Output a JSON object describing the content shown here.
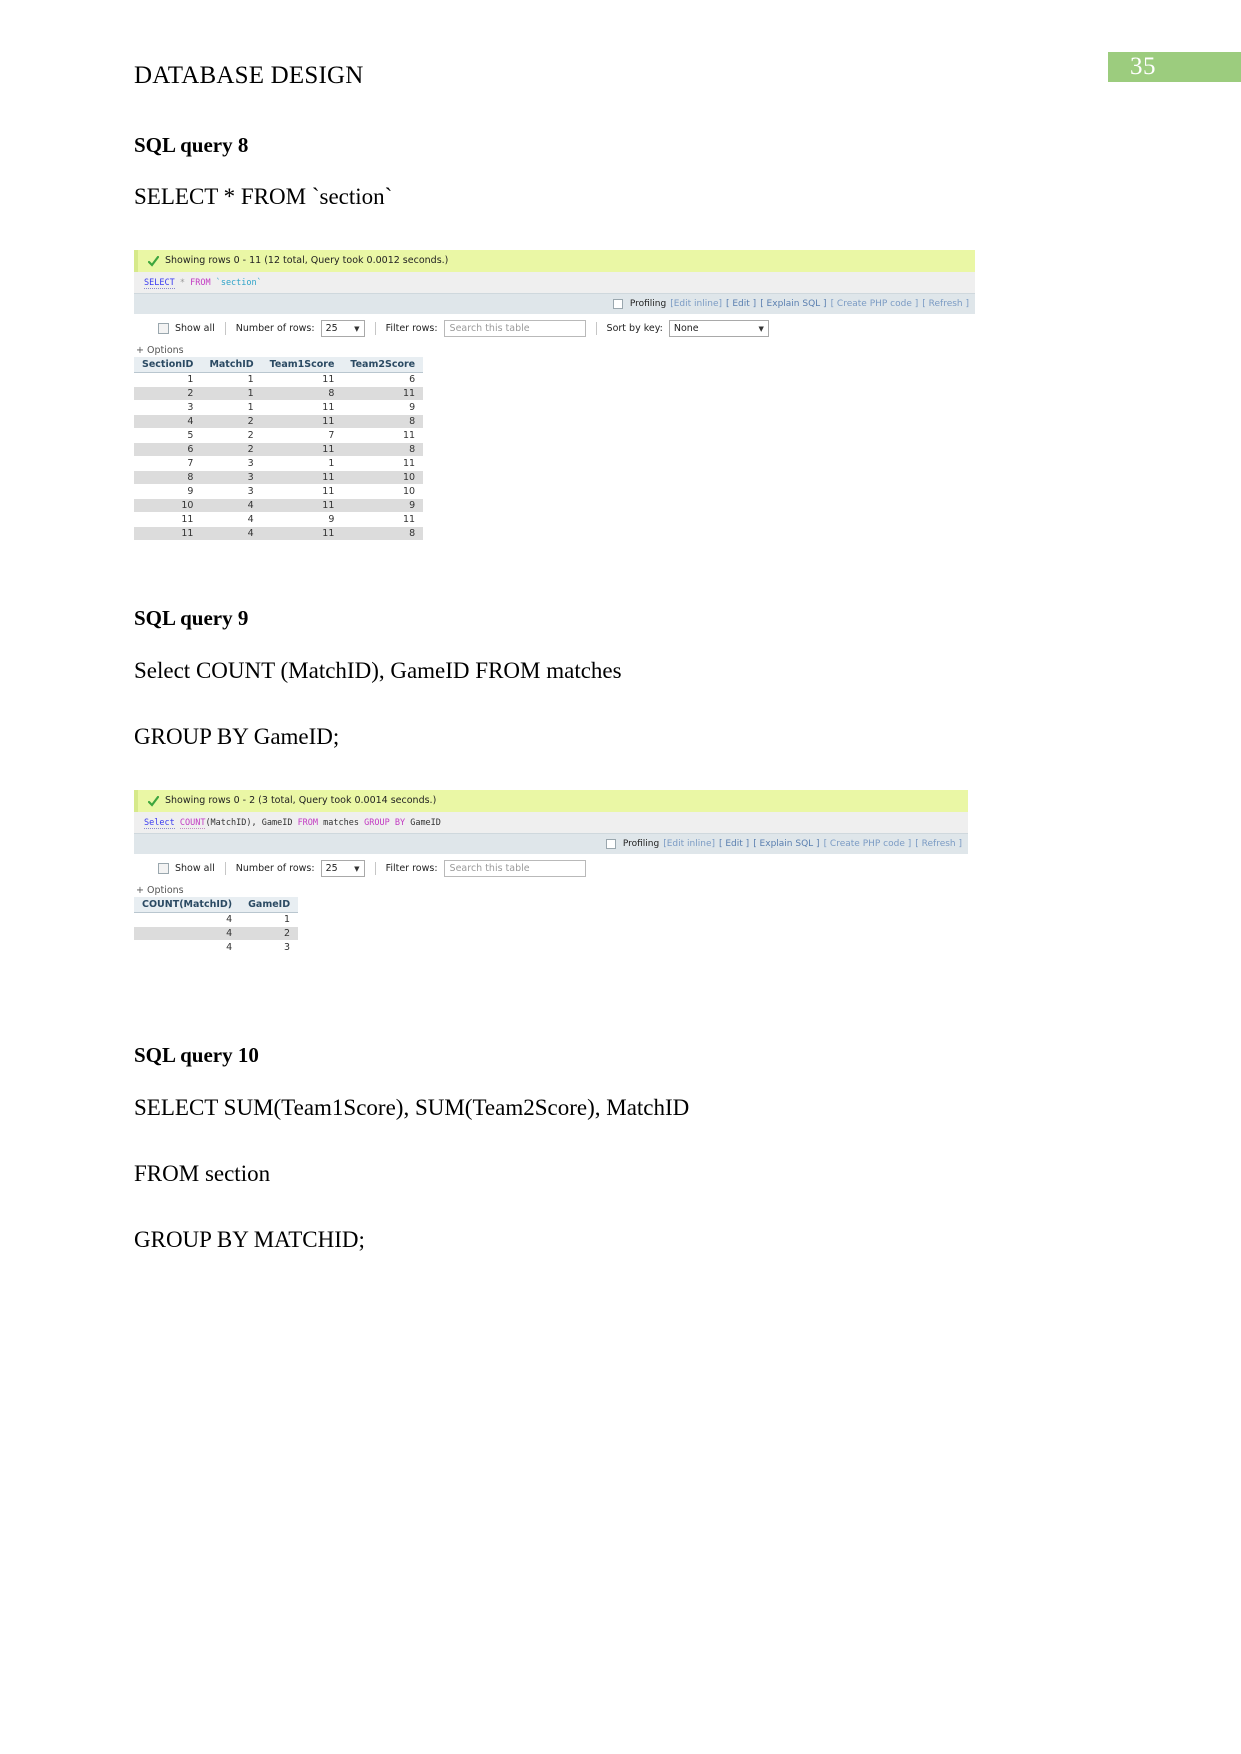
{
  "page": {
    "number": "35",
    "header_title": "DATABASE DESIGN",
    "badge_color": "#9ccc7e"
  },
  "sections": [
    {
      "heading": "SQL query 8",
      "lines": [
        "SELECT * FROM `section`"
      ]
    },
    {
      "heading": "SQL query 9",
      "lines": [
        "Select COUNT (MatchID), GameID FROM matches",
        "GROUP BY GameID;"
      ]
    },
    {
      "heading": "SQL query 10",
      "lines": [
        "SELECT SUM(Team1Score), SUM(Team2Score), MatchID",
        "FROM section",
        "GROUP BY MATCHID;"
      ]
    }
  ],
  "result1": {
    "status": "Showing rows 0 - 11 (12 total, Query took 0.0012 seconds.)",
    "sql": {
      "kw1": "SELECT",
      "star": "*",
      "kw2": "FROM",
      "ident": "`section`"
    },
    "actions": {
      "profiling": "Profiling",
      "edit_inline": "[Edit inline]",
      "edit": "[ Edit ]",
      "explain": "[ Explain SQL ]",
      "php": "[ Create PHP code ]",
      "refresh": "[ Refresh ]"
    },
    "toolbar": {
      "show_all": "Show all",
      "number_of_rows_label": "Number of rows:",
      "number_of_rows_value": "25",
      "filter_label": "Filter rows:",
      "filter_placeholder": "Search this table",
      "sort_label": "Sort by key:",
      "sort_value": "None",
      "options": "+ Options"
    },
    "table": {
      "columns": [
        "SectionID",
        "MatchID",
        "Team1Score",
        "Team2Score"
      ],
      "rows": [
        [
          "1",
          "1",
          "11",
          "6"
        ],
        [
          "2",
          "1",
          "8",
          "11"
        ],
        [
          "3",
          "1",
          "11",
          "9"
        ],
        [
          "4",
          "2",
          "11",
          "8"
        ],
        [
          "5",
          "2",
          "7",
          "11"
        ],
        [
          "6",
          "2",
          "11",
          "8"
        ],
        [
          "7",
          "3",
          "1",
          "11"
        ],
        [
          "8",
          "3",
          "11",
          "10"
        ],
        [
          "9",
          "3",
          "11",
          "10"
        ],
        [
          "10",
          "4",
          "11",
          "9"
        ],
        [
          "11",
          "4",
          "9",
          "11"
        ],
        [
          "11",
          "4",
          "11",
          "8"
        ]
      ]
    }
  },
  "result2": {
    "status": "Showing rows 0 - 2 (3 total, Query took 0.0014 seconds.)",
    "sql": {
      "kw1": "Select",
      "kw2": "COUNT",
      "mid": "(MatchID), GameID",
      "kw3": "FROM",
      "tbl": "matches",
      "kw4": "GROUP BY",
      "col": "GameID"
    },
    "actions": {
      "profiling": "Profiling",
      "edit_inline": "[Edit inline]",
      "edit": "[ Edit ]",
      "explain": "[ Explain SQL ]",
      "php": "[ Create PHP code ]",
      "refresh": "[ Refresh ]"
    },
    "toolbar": {
      "show_all": "Show all",
      "number_of_rows_label": "Number of rows:",
      "number_of_rows_value": "25",
      "filter_label": "Filter rows:",
      "filter_placeholder": "Search this table",
      "options": "+ Options"
    },
    "table": {
      "columns": [
        "COUNT(MatchID)",
        "GameID"
      ],
      "rows": [
        [
          "4",
          "1"
        ],
        [
          "4",
          "2"
        ],
        [
          "4",
          "3"
        ]
      ]
    }
  }
}
